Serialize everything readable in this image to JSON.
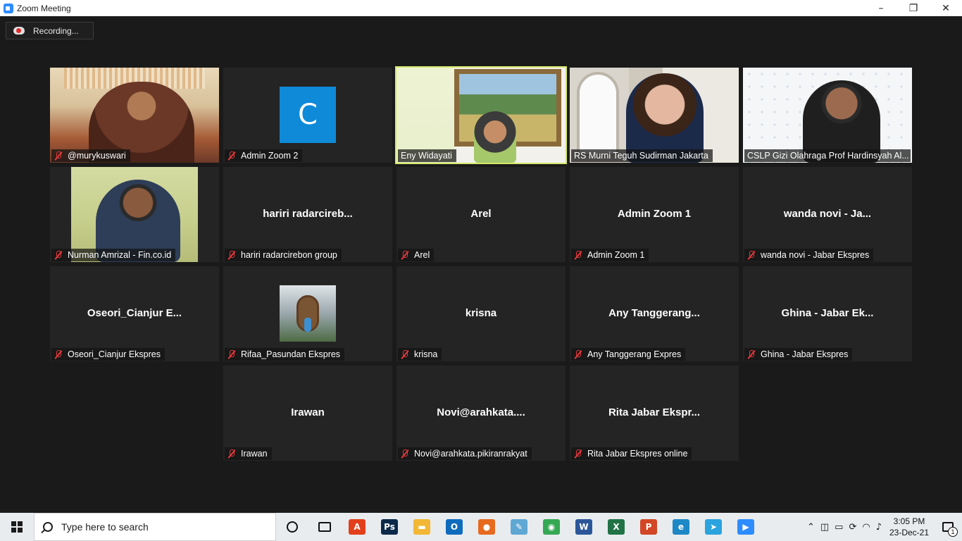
{
  "window": {
    "title": "Zoom Meeting",
    "minimize": "–",
    "restore": "❐",
    "close": "✕"
  },
  "recording": {
    "label": "Recording..."
  },
  "tiles": [
    {
      "name": "@murykuswari"
    },
    {
      "name": "Admin Zoom 2",
      "avatar_letter": "C"
    },
    {
      "name": "Eny Widayati"
    },
    {
      "name": "RS Murni Teguh Sudirman Jakarta"
    },
    {
      "name": "CSLP Gizi Olahraga Prof Hardinsyah Al..."
    },
    {
      "name": "Nurman Amrizal - Fin.co.id"
    },
    {
      "name": "hariri radarcirebon group",
      "display": "hariri radarcireb..."
    },
    {
      "name": "Arel",
      "display": "Arel"
    },
    {
      "name": "Admin Zoom 1",
      "display": "Admin Zoom 1"
    },
    {
      "name": "wanda novi - Jabar Ekspres",
      "display": "wanda novi - Ja..."
    },
    {
      "name": "Oseori_Cianjur Ekspres",
      "display": "Oseori_Cianjur  E..."
    },
    {
      "name": "Rifaa_Pasundan Ekspres"
    },
    {
      "name": "krisna",
      "display": "krisna"
    },
    {
      "name": "Any Tanggerang Expres",
      "display": "Any  Tanggerang..."
    },
    {
      "name": "Ghina - Jabar Ekspres",
      "display": "Ghina - Jabar Ek..."
    },
    {
      "name": "Irawan",
      "display": "Irawan"
    },
    {
      "name": "Novi@arahkata.pikiranrakyat",
      "display": "Novi@arahkata...."
    },
    {
      "name": "Rita Jabar Ekspres online",
      "display": "Rita Jabar Ekspr..."
    }
  ],
  "taskbar": {
    "search_placeholder": "Type here to search",
    "apps": [
      {
        "icon": "pdf-icon",
        "glyph": "A",
        "color": "#e2401c"
      },
      {
        "icon": "photoshop-icon",
        "glyph": "Ps",
        "color": "#0b2a4a"
      },
      {
        "icon": "file-explorer-icon",
        "glyph": "▬",
        "color": "#f2b735"
      },
      {
        "icon": "outlook-icon",
        "glyph": "O",
        "color": "#0f6cbd"
      },
      {
        "icon": "firefox-icon",
        "glyph": "●",
        "color": "#e66a1f"
      },
      {
        "icon": "notepad-icon",
        "glyph": "✎",
        "color": "#5fa8d3"
      },
      {
        "icon": "chrome-icon",
        "glyph": "◉",
        "color": "#34a853"
      },
      {
        "icon": "word-icon",
        "glyph": "W",
        "color": "#2b579a"
      },
      {
        "icon": "excel-icon",
        "glyph": "X",
        "color": "#217346"
      },
      {
        "icon": "powerpoint-icon",
        "glyph": "P",
        "color": "#d24726"
      },
      {
        "icon": "edge-icon",
        "glyph": "e",
        "color": "#1e88c7"
      },
      {
        "icon": "telegram-icon",
        "glyph": "➤",
        "color": "#2aa3de"
      },
      {
        "icon": "zoom-icon",
        "glyph": "▶",
        "color": "#2d8cff"
      }
    ],
    "time": "3:05 PM",
    "date": "23-Dec-21",
    "notification_count": "1"
  }
}
